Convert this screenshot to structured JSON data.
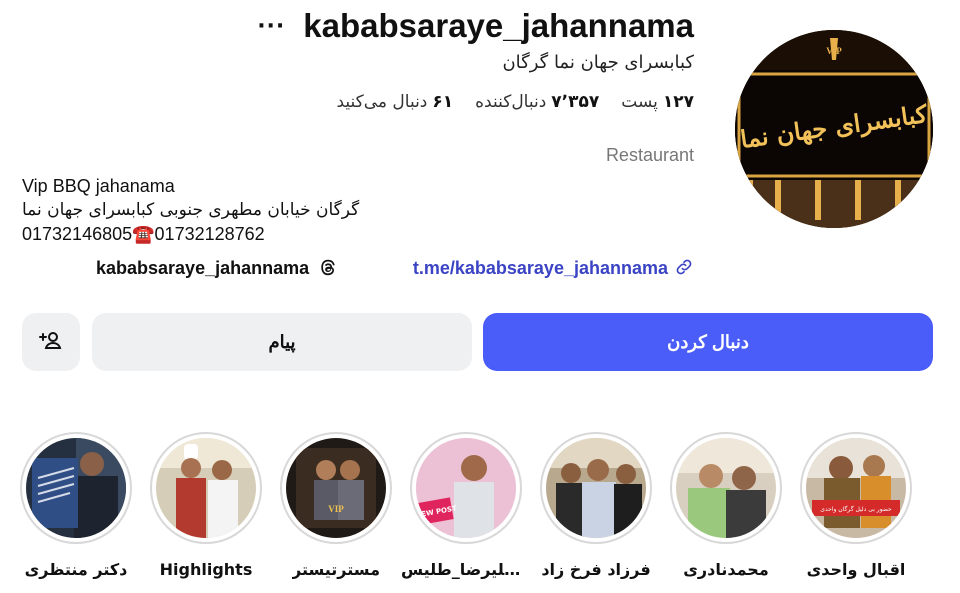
{
  "profile": {
    "username": "kababsaraye_jahannama",
    "full_name": "کبابسرای جهان نما گرگان",
    "avatar_sign_text": "کبابسرای جهان نما",
    "avatar_logo_text": "VIP",
    "category": "Restaurant"
  },
  "stats": {
    "posts": {
      "value": "۱۲۷",
      "label": "پست"
    },
    "followers": {
      "value": "۷٬۳۵۷",
      "label": "دنبال‌کننده"
    },
    "following": {
      "value": "۶۱",
      "label": "دنبال می‌کنید"
    }
  },
  "bio": {
    "line1": "Vip BBQ jahanama",
    "line2": "گرگان خیابان مطهری جنوبی کبابسرای جهان نما",
    "phone1": "01732146805",
    "phone_icon": "☎️",
    "phone2": "01732128762"
  },
  "links": {
    "threads": "kababsaraye_jahannama",
    "website": "t.me/kababsaraye_jahannama"
  },
  "buttons": {
    "follow": "دنبال کردن",
    "message": "پیام"
  },
  "highlights": [
    {
      "label": "اقبال واحدی",
      "thumb_text": "حضور بی دلیل گرگان واحدی"
    },
    {
      "label": "محمدنادری",
      "thumb_text": ""
    },
    {
      "label": "فرزاد فرخ زاد",
      "thumb_text": ""
    },
    {
      "label": "علیرضا_طلیس...",
      "thumb_text": "NEW POST"
    },
    {
      "label": "مسترتیستر",
      "thumb_text": "VIP"
    },
    {
      "label": "Highlights",
      "thumb_text": ""
    },
    {
      "label": "دکتر منتظری",
      "thumb_text": ""
    }
  ],
  "colors": {
    "accent": "#4a5df9",
    "link": "#3b44c4",
    "secondary_button": "#eff0f2",
    "muted_text": "#777777"
  },
  "icons": {
    "more": "more-horizontal-icon",
    "threads": "threads-icon",
    "link": "link-chain-icon",
    "suggest": "add-person-icon"
  }
}
